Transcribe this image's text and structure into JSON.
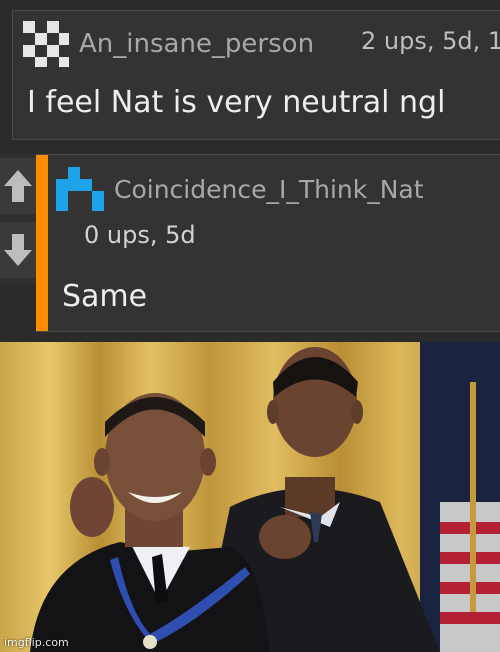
{
  "comments": [
    {
      "username": "An_insane_person",
      "meta": "2 ups, 5d, 1",
      "body": "I feel Nat is very neutral ngl",
      "avatar_color": "#e6e6e6"
    },
    {
      "username": "Coincidence_I_Think_Nat",
      "meta": "0 ups, 5d",
      "body": "Same",
      "avatar_color": "#1fa3e8",
      "accent_color": "#ff8c00"
    }
  ],
  "votes": {
    "up_icon": "arrow-up-icon",
    "down_icon": "arrow-down-icon"
  },
  "watermark": "imgflip.com"
}
